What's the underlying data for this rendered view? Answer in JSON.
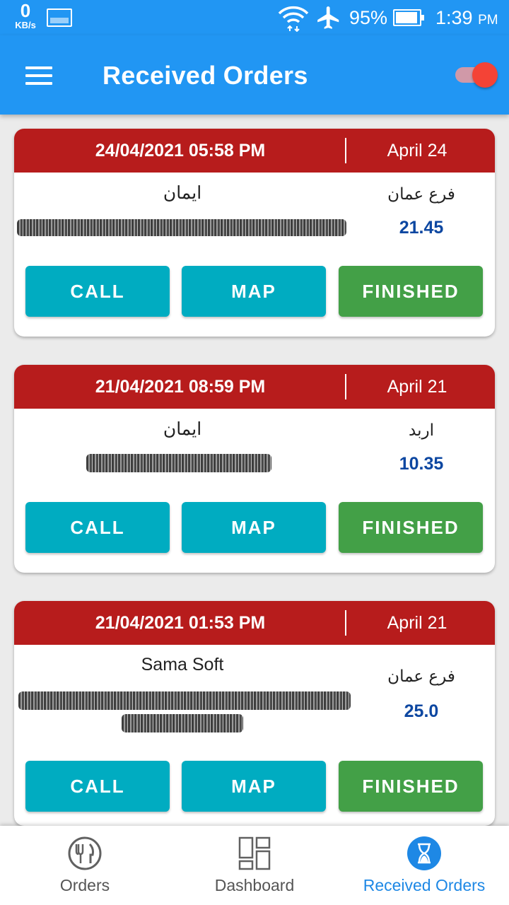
{
  "status_bar": {
    "net_speed_value": "0",
    "net_speed_unit": "KB/s",
    "battery_percent": "95%",
    "time": "1:39",
    "time_suffix": "PM",
    "icons": [
      "image-icon",
      "wifi-icon",
      "airplane-mode-icon",
      "battery-icon"
    ]
  },
  "app_bar": {
    "title": "Received Orders",
    "menu_icon": "hamburger-menu-icon",
    "toggle_on": true,
    "colors": {
      "primary": "#2196f3",
      "toggle_thumb": "#f44336"
    }
  },
  "orders": [
    {
      "datetime": "24/04/2021 05:58 PM",
      "day_label": "April 24",
      "customer": "ايمان",
      "branch": "فرع عمان",
      "amount": "21.45",
      "call_label": "CALL",
      "map_label": "MAP",
      "finished_label": "FINISHED"
    },
    {
      "datetime": "21/04/2021 08:59 PM",
      "day_label": "April 21",
      "customer": "ايمان",
      "branch": "اربد",
      "amount": "10.35",
      "call_label": "CALL",
      "map_label": "MAP",
      "finished_label": "FINISHED"
    },
    {
      "datetime": "21/04/2021 01:53 PM",
      "day_label": "April 21",
      "customer": "Sama Soft",
      "branch": "فرع عمان",
      "amount": "25.0",
      "call_label": "CALL",
      "map_label": "MAP",
      "finished_label": "FINISHED"
    }
  ],
  "card_colors": {
    "header": "#b71c1c",
    "call_button": "#00acc1",
    "map_button": "#00acc1",
    "finished_button": "#43a047",
    "amount_text": "#0d47a1"
  },
  "bottom_nav": {
    "items": [
      {
        "label": "Orders",
        "icon": "fork-knife-plate-icon",
        "active": false
      },
      {
        "label": "Dashboard",
        "icon": "dashboard-grid-icon",
        "active": false
      },
      {
        "label": "Received Orders",
        "icon": "hourglass-icon",
        "active": true
      }
    ],
    "active_color": "#1e88e5"
  }
}
